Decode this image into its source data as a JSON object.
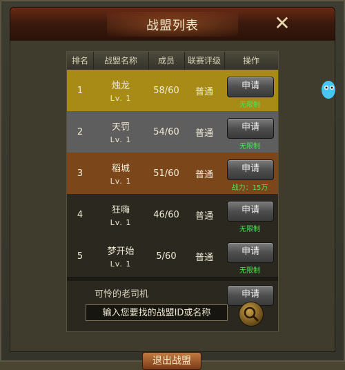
{
  "window": {
    "title": "战盟列表"
  },
  "table": {
    "headers": [
      "排名",
      "战盟名称",
      "成员",
      "联赛评级",
      "操作"
    ],
    "rows": [
      {
        "rank": "1",
        "name": "烛龙",
        "level": "Lv. 1",
        "members": "58/60",
        "rating": "普通",
        "button": "申请",
        "limit": "无限制",
        "color": "#a88a16"
      },
      {
        "rank": "2",
        "name": "天罚",
        "level": "Lv. 1",
        "members": "54/60",
        "rating": "普通",
        "button": "申请",
        "limit": "无限制",
        "color": "#5e5e5e"
      },
      {
        "rank": "3",
        "name": "稻城",
        "level": "Lv. 1",
        "members": "51/60",
        "rating": "普通",
        "button": "申请",
        "limit": "战力：15万",
        "color": "#7a461a"
      },
      {
        "rank": "4",
        "name": "狂嗨",
        "level": "Lv. 1",
        "members": "46/60",
        "rating": "普通",
        "button": "申请",
        "limit": "无限制",
        "color": "#2b2820"
      },
      {
        "rank": "5",
        "name": "梦开始",
        "level": "Lv. 1",
        "members": "5/60",
        "rating": "普通",
        "button": "申请",
        "limit": "无限制",
        "color": "#2b2820"
      }
    ],
    "partial_row": {
      "name": "可怜的老司机",
      "button": "申请"
    }
  },
  "search": {
    "placeholder": "输入您要找的战盟ID或名称"
  },
  "footer": {
    "button": "退出战盟"
  },
  "colors": {
    "accent_green": "#53e05a",
    "title_bar": "#4a1c0c"
  }
}
